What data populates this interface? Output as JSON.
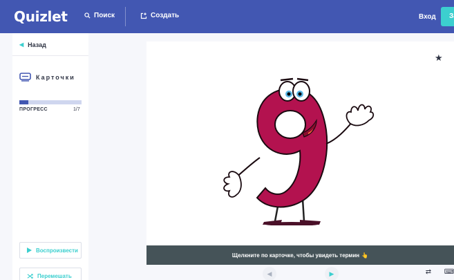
{
  "header": {
    "logo": "Quizlet",
    "search_label": "Поиск",
    "create_label": "Создать",
    "login_label": "Вход",
    "signup_label": "За",
    "colors": {
      "background": "#4257b2",
      "accent": "#3ccfcf"
    }
  },
  "sidebar": {
    "back_label": "Назад",
    "mode_label": "Карточки",
    "progress_label": "ПРОГРЕСС",
    "progress_count": "1/7",
    "progress_fraction": 0.14,
    "play_label": "Воспроизвести",
    "shuffle_label": "Перемешать"
  },
  "card": {
    "hint_text": "Щелкните по карточке, чтобы увидеть термин",
    "hint_emoji": "👆",
    "image_subject": "cartoon-number-nine-character",
    "colors": {
      "nine": "#b3124f",
      "hint_bar": "#455358"
    }
  },
  "controls": {
    "prev_icon": "chevron-left-icon",
    "next_icon": "chevron-right-icon",
    "swap_icon": "swap-icon",
    "keyboard_icon": "keyboard-icon"
  }
}
